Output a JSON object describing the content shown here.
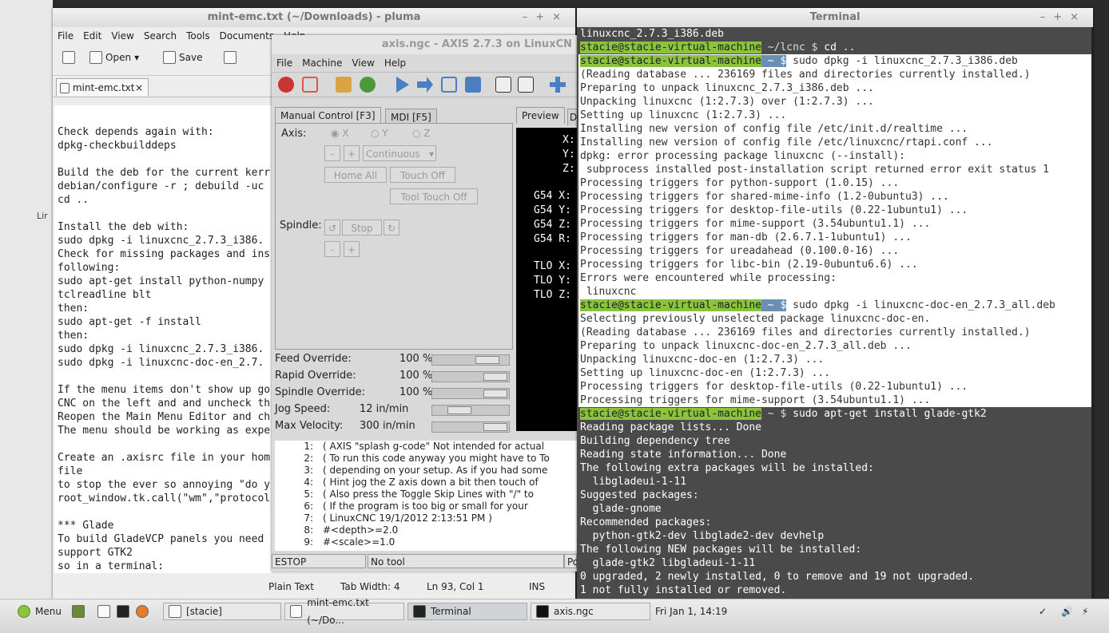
{
  "desktop": {
    "label": "Lir"
  },
  "pluma": {
    "title": "mint-emc.txt (~/Downloads) - pluma",
    "menu": [
      "File",
      "Edit",
      "View",
      "Search",
      "Tools",
      "Documents",
      "Help"
    ],
    "toolbar": {
      "open_label": "Open",
      "save_label": "Save"
    },
    "tab_label": "mint-emc.txt",
    "text_lines": [
      "",
      "Check depends again with:",
      "dpkg-checkbuilddeps",
      "",
      "Build the deb for the current kerr",
      "debian/configure -r ; debuild -uc",
      "cd ..",
      "",
      "Install the deb with:",
      "sudo dpkg -i linuxcnc_2.7.3_i386.",
      "Check for missing packages and ins",
      "following:",
      "sudo apt-get install python-numpy",
      "tclreadline blt",
      "then:",
      "sudo apt-get -f install",
      "then:",
      "sudo dpkg -i linuxcnc_2.7.3_i386.",
      "sudo dpkg -i linuxcnc-doc-en_2.7.",
      "",
      "If the menu items don't show up go",
      "CNC on the left and and uncheck th",
      "Reopen the Main Menu Editor and ch",
      "The menu should be working as expe",
      "",
      "Create an .axisrc file in your hom",
      "file",
      "to stop the ever so annoying \"do y",
      "root_window.tk.call(\"wm\",\"protocol",
      "",
      "*** Glade",
      "To build GladeVCP panels you need",
      "support GTK2",
      "so in a terminal:",
      "sudo apt-get install glade-gtk2"
    ],
    "status": {
      "lang": "Plain Text",
      "tab_width": "Tab Width:  4",
      "position": "Ln 93, Col 1",
      "mode": "INS"
    }
  },
  "axis": {
    "title": "axis.ngc - AXIS 2.7.3 on LinuxCN",
    "menu": [
      "File",
      "Machine",
      "View",
      "Help"
    ],
    "tabs": {
      "manual": "Manual Control [F3]",
      "mdi": "MDI [F5]",
      "preview": "Preview",
      "dro": "D"
    },
    "axis_label": "Axis:",
    "axes": [
      "X",
      "Y",
      "Z"
    ],
    "jog": {
      "minus": "-",
      "plus": "+",
      "mode": "Continuous"
    },
    "buttons": {
      "home_all": "Home All",
      "touch_off": "Touch Off",
      "tool_touch_off": "Tool Touch Off",
      "stop": "Stop"
    },
    "spindle_label": "Spindle:",
    "overrides": [
      {
        "label": "Feed Override:",
        "value": "100 %",
        "level": 0.85
      },
      {
        "label": "Rapid Override:",
        "value": "100 %",
        "level": 1.0
      },
      {
        "label": "Spindle Override:",
        "value": "100 %",
        "level": 1.0
      },
      {
        "label": "Jog Speed:",
        "value": "12 in/min",
        "level": 0.3
      },
      {
        "label": "Max Velocity:",
        "value": "300 in/min",
        "level": 1.0
      }
    ],
    "preview_text": [
      "X:",
      "Y:",
      "Z:",
      "G54 X:",
      "G54 Y:",
      "G54 Z:",
      "G54 R:",
      "TLO X:",
      "TLO Y:",
      "TLO Z:"
    ],
    "gcode": [
      {
        "n": "1:",
        "t": "( AXIS \"splash g-code\" Not intended for actual"
      },
      {
        "n": "2:",
        "t": "( To run this code anyway you might have to To"
      },
      {
        "n": "3:",
        "t": "( depending on your setup. As if you had some"
      },
      {
        "n": "4:",
        "t": "( Hint jog the Z axis down a bit then touch of"
      },
      {
        "n": "5:",
        "t": "( Also press the Toggle Skip Lines with \"/\" to"
      },
      {
        "n": "6:",
        "t": "( If the program is too big or small for your"
      },
      {
        "n": "7:",
        "t": "( LinuxCNC 19/1/2012 2:13:51 PM )"
      },
      {
        "n": "8:",
        "t": "#<depth>=2.0"
      },
      {
        "n": "9:",
        "t": "#<scale>=1.0"
      }
    ],
    "status": {
      "estop": "ESTOP",
      "tool": "No tool",
      "pos": "Po"
    }
  },
  "terminal": {
    "title": "Terminal",
    "lines": [
      {
        "s": "d",
        "text": "linuxcnc_2.7.3_i386.deb"
      },
      {
        "s": "d",
        "user": "stacie@stacie-virtual-machine",
        "path": "~/lcnc $",
        "text": " cd .."
      },
      {
        "s": "w",
        "user": "stacie@stacie-virtual-machine",
        "path": "~ $",
        "text": " sudo dpkg -i linuxcnc_2.7.3_i386.deb"
      },
      {
        "s": "w",
        "text": "(Reading database ... 236169 files and directories currently installed.)"
      },
      {
        "s": "w",
        "text": "Preparing to unpack linuxcnc_2.7.3_i386.deb ..."
      },
      {
        "s": "w",
        "text": "Unpacking linuxcnc (1:2.7.3) over (1:2.7.3) ..."
      },
      {
        "s": "w",
        "text": "Setting up linuxcnc (1:2.7.3) ..."
      },
      {
        "s": "w",
        "text": "Installing new version of config file /etc/init.d/realtime ..."
      },
      {
        "s": "w",
        "text": "Installing new version of config file /etc/linuxcnc/rtapi.conf ..."
      },
      {
        "s": "w",
        "text": "dpkg: error processing package linuxcnc (--install):"
      },
      {
        "s": "w",
        "text": " subprocess installed post-installation script returned error exit status 1"
      },
      {
        "s": "w",
        "text": "Processing triggers for python-support (1.0.15) ..."
      },
      {
        "s": "w",
        "text": "Processing triggers for shared-mime-info (1.2-0ubuntu3) ..."
      },
      {
        "s": "w",
        "text": "Processing triggers for desktop-file-utils (0.22-1ubuntu1) ..."
      },
      {
        "s": "w",
        "text": "Processing triggers for mime-support (3.54ubuntu1.1) ..."
      },
      {
        "s": "w",
        "text": "Processing triggers for man-db (2.6.7.1-1ubuntu1) ..."
      },
      {
        "s": "w",
        "text": "Processing triggers for ureadahead (0.100.0-16) ..."
      },
      {
        "s": "w",
        "text": "Processing triggers for libc-bin (2.19-0ubuntu6.6) ..."
      },
      {
        "s": "w",
        "text": "Errors were encountered while processing:"
      },
      {
        "s": "w",
        "text": " linuxcnc"
      },
      {
        "s": "w",
        "user": "stacie@stacie-virtual-machine",
        "path": "~ $",
        "text": " sudo dpkg -i linuxcnc-doc-en_2.7.3_all.deb"
      },
      {
        "s": "w",
        "text": "Selecting previously unselected package linuxcnc-doc-en."
      },
      {
        "s": "w",
        "text": "(Reading database ... 236169 files and directories currently installed.)"
      },
      {
        "s": "w",
        "text": "Preparing to unpack linuxcnc-doc-en_2.7.3_all.deb ..."
      },
      {
        "s": "w",
        "text": "Unpacking linuxcnc-doc-en (1:2.7.3) ..."
      },
      {
        "s": "w",
        "text": "Setting up linuxcnc-doc-en (1:2.7.3) ..."
      },
      {
        "s": "w",
        "text": "Processing triggers for desktop-file-utils (0.22-1ubuntu1) ..."
      },
      {
        "s": "w",
        "text": "Processing triggers for mime-support (3.54ubuntu1.1) ..."
      },
      {
        "s": "d",
        "user": "stacie@stacie-virtual-machine",
        "path": "~ $",
        "text": " sudo apt-get install glade-gtk2"
      },
      {
        "s": "d",
        "text": "Reading package lists... Done"
      },
      {
        "s": "d",
        "text": "Building dependency tree"
      },
      {
        "s": "d",
        "text": "Reading state information... Done"
      },
      {
        "s": "d",
        "text": "The following extra packages will be installed:"
      },
      {
        "s": "d",
        "text": "  libgladeui-1-11"
      },
      {
        "s": "d",
        "text": "Suggested packages:"
      },
      {
        "s": "d",
        "text": "  glade-gnome"
      },
      {
        "s": "d",
        "text": "Recommended packages:"
      },
      {
        "s": "d",
        "text": "  python-gtk2-dev libglade2-dev devhelp"
      },
      {
        "s": "d",
        "text": "The following NEW packages will be installed:"
      },
      {
        "s": "d",
        "text": "  glade-gtk2 libgladeui-1-11"
      },
      {
        "s": "d",
        "text": "0 upgraded, 2 newly installed, 0 to remove and 19 not upgraded."
      },
      {
        "s": "d",
        "text": "1 not fully installed or removed."
      }
    ]
  },
  "taskbar": {
    "menu_label": "Menu",
    "tasks": [
      "[stacie]",
      "mint-emc.txt (~/Do...",
      "Terminal",
      "axis.ngc"
    ],
    "clock": "Fri Jan  1, 14:19"
  }
}
